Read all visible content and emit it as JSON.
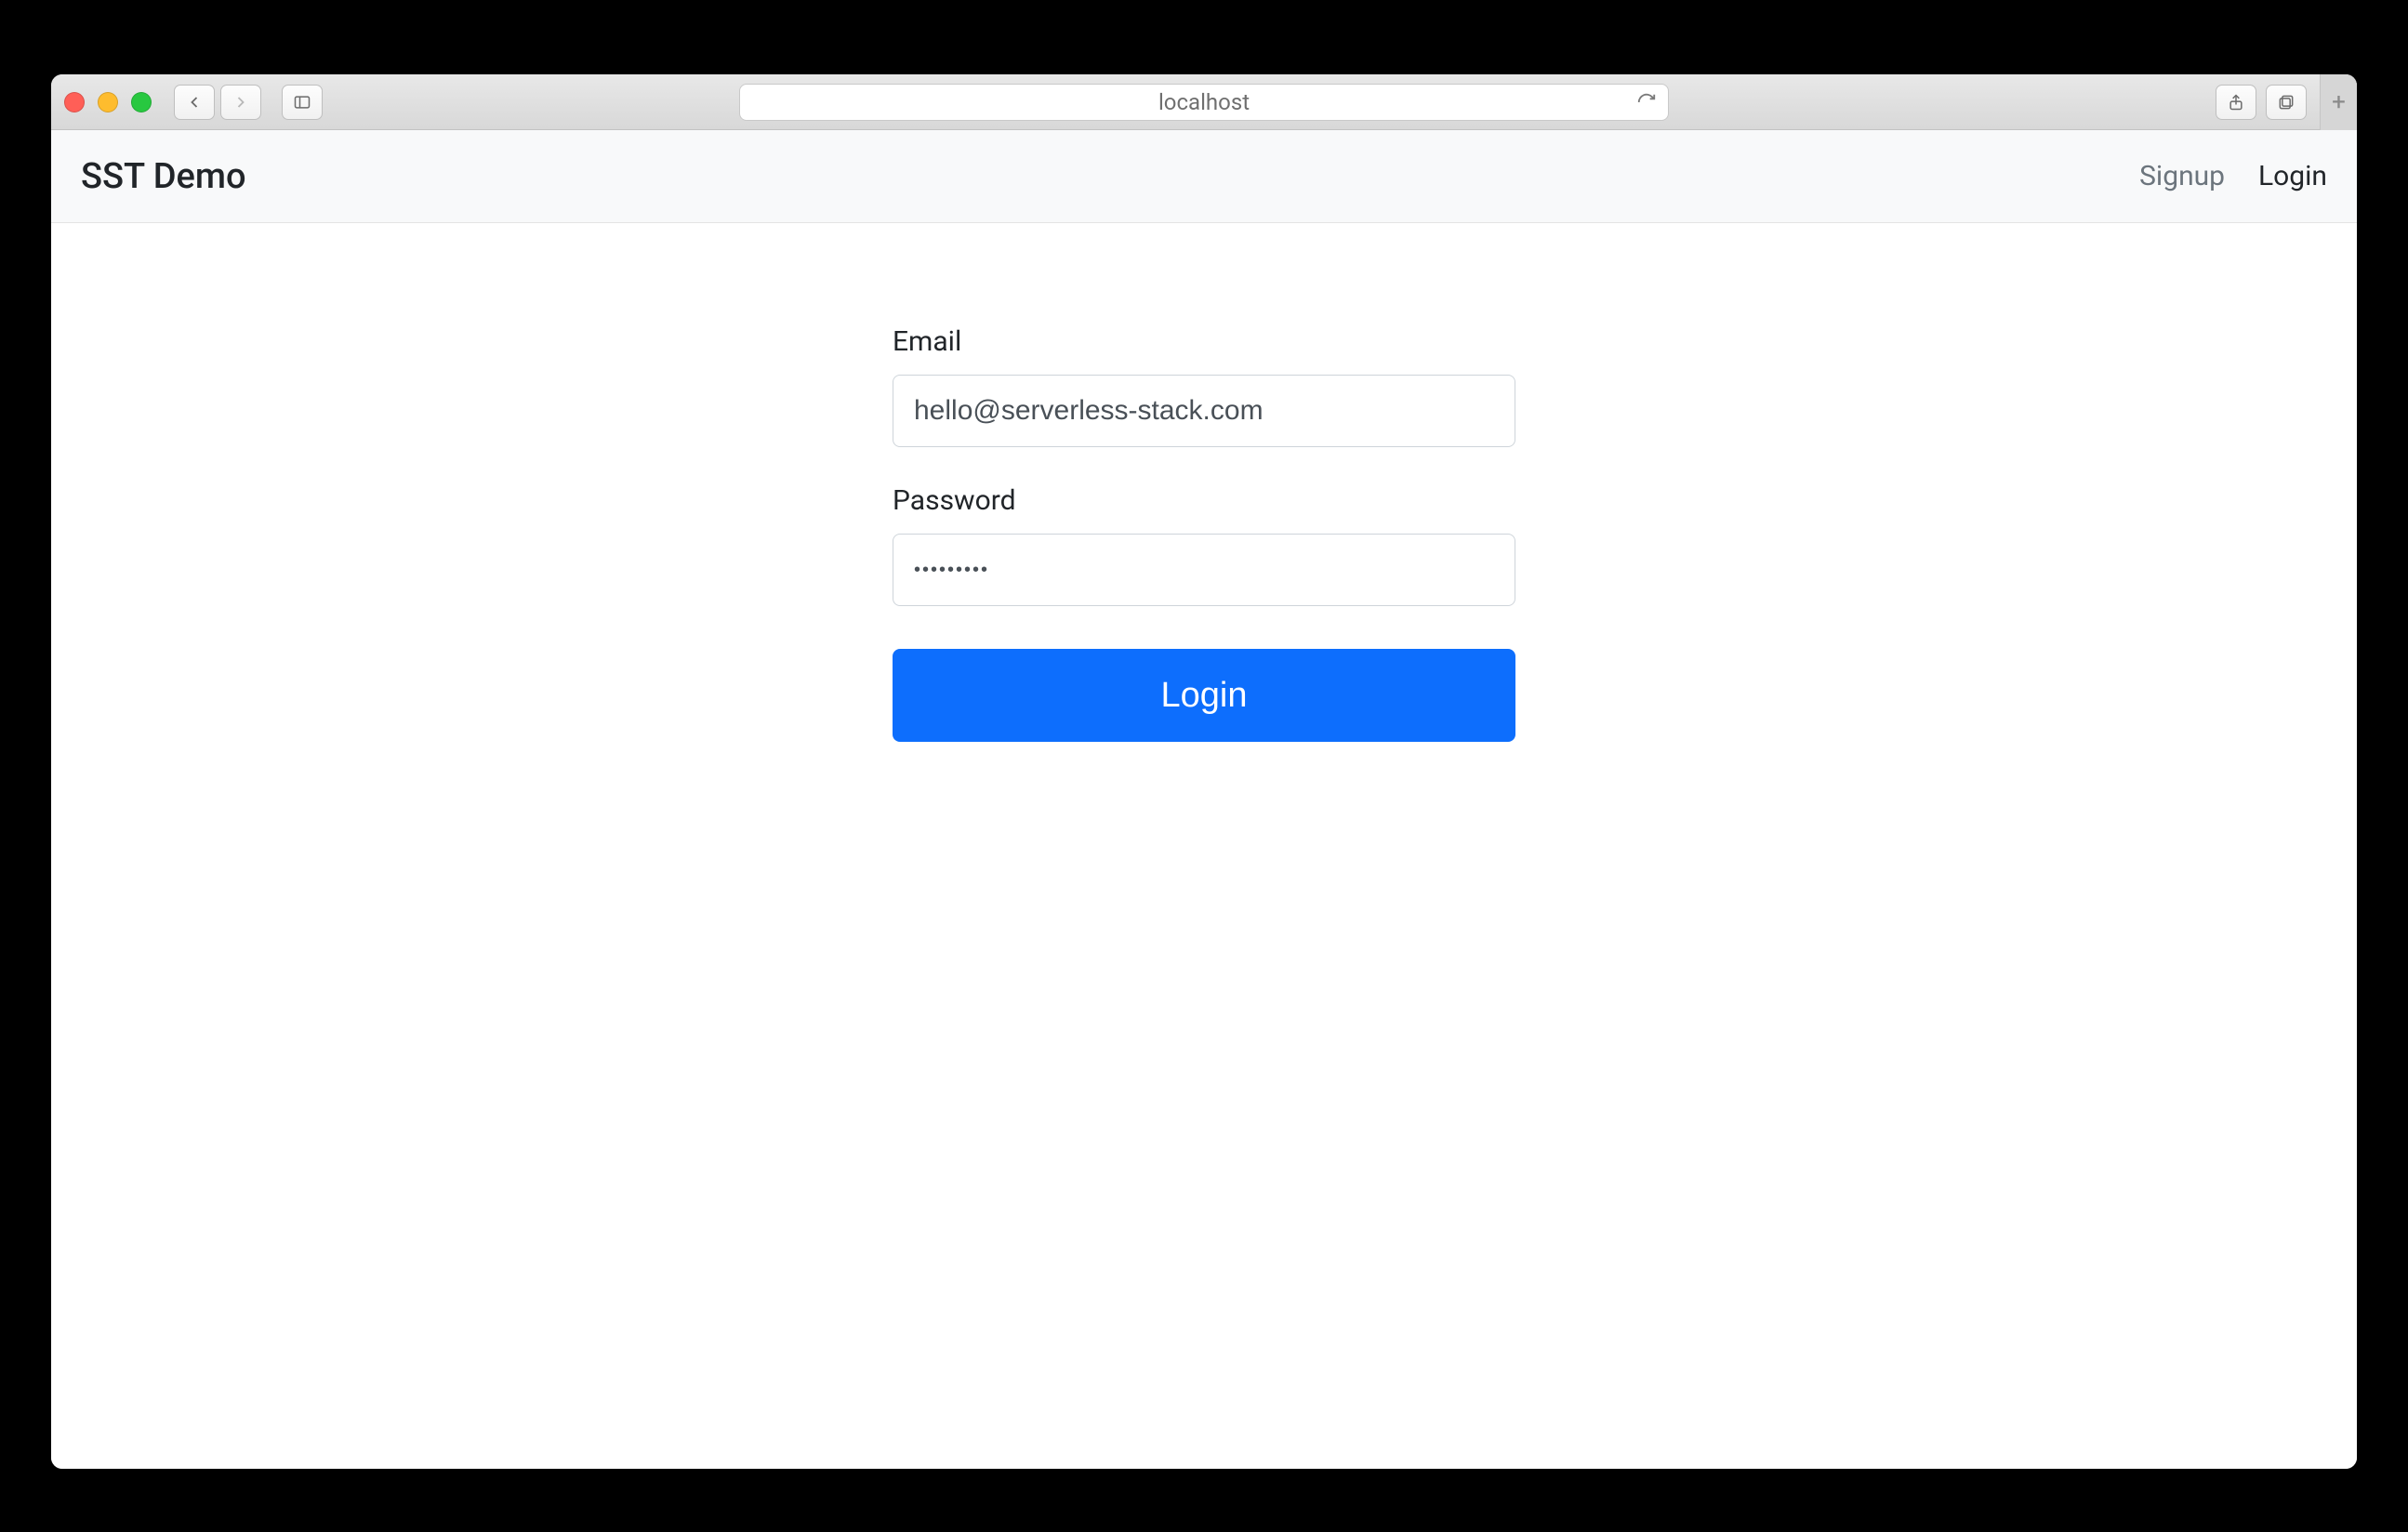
{
  "browser": {
    "address": "localhost"
  },
  "navbar": {
    "brand": "SST Demo",
    "signup_label": "Signup",
    "login_label": "Login"
  },
  "form": {
    "email_label": "Email",
    "email_value": "hello@serverless-stack.com",
    "password_label": "Password",
    "password_value": "•••••••••",
    "submit_label": "Login"
  }
}
